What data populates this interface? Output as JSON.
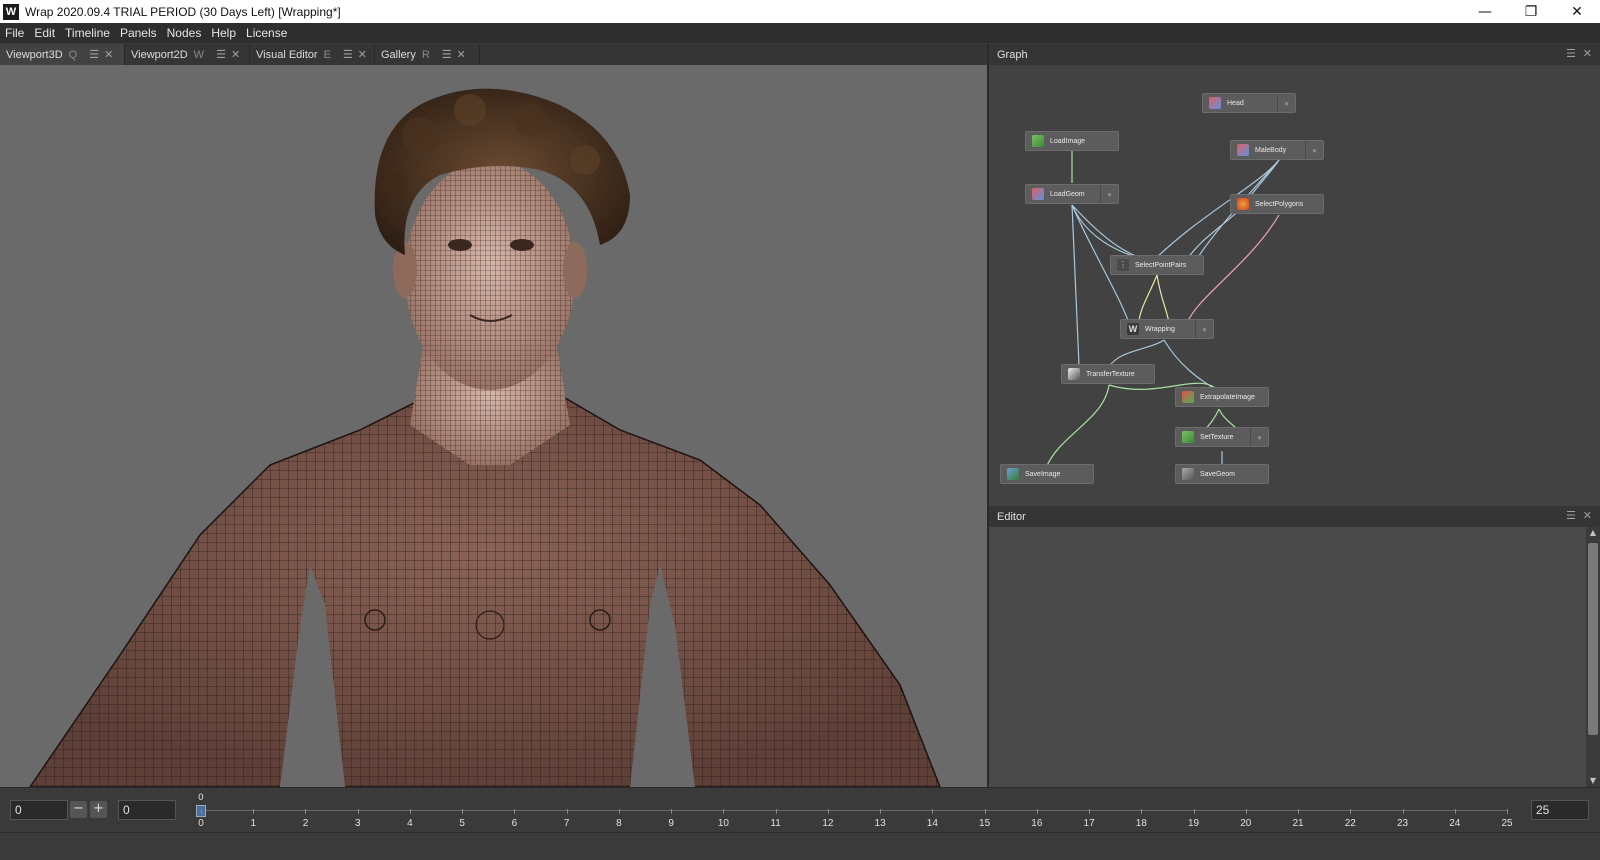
{
  "window": {
    "title": "Wrap 2020.09.4 TRIAL PERIOD (30 Days Left) [Wrapping*]",
    "logo": "W",
    "controls": {
      "minimize": "—",
      "restore": "❐",
      "close": "✕"
    }
  },
  "menu": [
    "File",
    "Edit",
    "Timeline",
    "Panels",
    "Nodes",
    "Help",
    "License"
  ],
  "tabs": [
    {
      "label": "Viewport3D",
      "key": "Q"
    },
    {
      "label": "Viewport2D",
      "key": "W"
    },
    {
      "label": "Visual Editor",
      "key": "E"
    },
    {
      "label": "Gallery",
      "key": "R"
    }
  ],
  "panels": {
    "graph_title": "Graph",
    "editor_title": "Editor"
  },
  "graph": {
    "nodes": [
      {
        "id": "head",
        "label": "Head",
        "icon": "geom-icon"
      },
      {
        "id": "loadimage",
        "label": "LoadImage",
        "icon": "image-icon"
      },
      {
        "id": "malebody",
        "label": "MaleBody",
        "icon": "geom-icon"
      },
      {
        "id": "loadgeom",
        "label": "LoadGeom",
        "icon": "geom-icon"
      },
      {
        "id": "selectpolygons",
        "label": "SelectPolygons",
        "icon": "select-icon"
      },
      {
        "id": "selectpointpairs",
        "label": "SelectPointPairs",
        "icon": "points-icon"
      },
      {
        "id": "wrapping",
        "label": "Wrapping",
        "icon": "wrap-icon"
      },
      {
        "id": "transfertexture",
        "label": "TransferTexture",
        "icon": "texture-icon"
      },
      {
        "id": "extrapolateimage",
        "label": "ExtrapolateImage",
        "icon": "extrapolate-icon"
      },
      {
        "id": "settexture",
        "label": "SetTexture",
        "icon": "image-icon"
      },
      {
        "id": "saveimage",
        "label": "SaveImage",
        "icon": "save-image-icon"
      },
      {
        "id": "savegeom",
        "label": "SaveGeom",
        "icon": "save-geom-icon"
      }
    ]
  },
  "timeline": {
    "start_value": "0",
    "current_value": "0",
    "end_value": "25",
    "marker_label": "0",
    "ticks": [
      "0",
      "1",
      "2",
      "3",
      "4",
      "5",
      "6",
      "7",
      "8",
      "9",
      "10",
      "11",
      "12",
      "13",
      "14",
      "15",
      "16",
      "17",
      "18",
      "19",
      "20",
      "21",
      "22",
      "23",
      "24",
      "25"
    ]
  },
  "colors": {
    "accent": "#4a6f9a",
    "panel_bg": "#424242",
    "viewport_bg": "#6a6a6a",
    "skin": "#7a5548"
  }
}
